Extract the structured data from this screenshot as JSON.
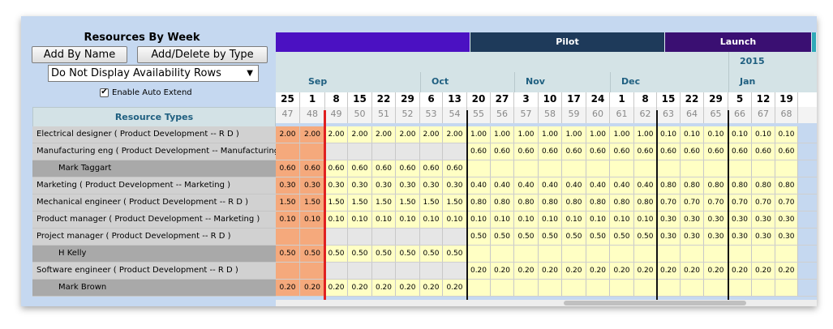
{
  "panel": {
    "title": "Resources By Week",
    "add_by_name_label": "Add By Name",
    "add_delete_label": "Add/Delete by Type",
    "availability_select": "Do Not Display Availability Rows",
    "auto_extend_label": "Enable Auto Extend",
    "auto_extend_checked": "✔"
  },
  "resource_header": "Resource Types",
  "phases": [
    {
      "label": "",
      "color": "#4b11c2"
    },
    {
      "label": "Pilot",
      "color": "#1e3a5a"
    },
    {
      "label": "Launch",
      "color": "#3a0f72"
    }
  ],
  "year_label": "2015",
  "months": [
    "Sep",
    "Oct",
    "Nov",
    "Dec",
    "Jan"
  ],
  "days": [
    "25",
    "1",
    "8",
    "15",
    "22",
    "29",
    "6",
    "13",
    "20",
    "27",
    "3",
    "10",
    "17",
    "24",
    "1",
    "8",
    "15",
    "22",
    "29",
    "5",
    "12",
    "19"
  ],
  "weeks": [
    "47",
    "48",
    "49",
    "50",
    "51",
    "52",
    "53",
    "54",
    "55",
    "56",
    "57",
    "58",
    "59",
    "60",
    "61",
    "62",
    "63",
    "64",
    "65",
    "66",
    "67",
    "68"
  ],
  "colors": {
    "past": "#f5a97c",
    "active": "#ffffc4",
    "empty": "#e6e6e6",
    "type_row": "#d1d1d1",
    "person_row": "#a9a9a9"
  },
  "rows": [
    {
      "label": "Electrical designer ( Product Development -- R D )",
      "kind": "type",
      "values": [
        "2.00",
        "2.00",
        "2.00",
        "2.00",
        "2.00",
        "2.00",
        "2.00",
        "2.00",
        "1.00",
        "1.00",
        "1.00",
        "1.00",
        "1.00",
        "1.00",
        "1.00",
        "1.00",
        "0.10",
        "0.10",
        "0.10",
        "0.10",
        "0.10",
        "0.10"
      ]
    },
    {
      "label": "Manufacturing eng ( Product Development -- Manufacturing )",
      "kind": "type",
      "values": [
        "",
        "",
        "",
        "",
        "",
        "",
        "",
        "",
        "0.60",
        "0.60",
        "0.60",
        "0.60",
        "0.60",
        "0.60",
        "0.60",
        "0.60",
        "0.60",
        "0.60",
        "0.60",
        "0.60",
        "0.60",
        "0.60"
      ]
    },
    {
      "label": "Mark Taggart",
      "kind": "person",
      "values": [
        "0.60",
        "0.60",
        "0.60",
        "0.60",
        "0.60",
        "0.60",
        "0.60",
        "0.60",
        "",
        "",
        "",
        "",
        "",
        "",
        "",
        "",
        "",
        "",
        "",
        "",
        "",
        ""
      ]
    },
    {
      "label": "Marketing ( Product Development -- Marketing )",
      "kind": "type",
      "values": [
        "0.30",
        "0.30",
        "0.30",
        "0.30",
        "0.30",
        "0.30",
        "0.30",
        "0.30",
        "0.40",
        "0.40",
        "0.40",
        "0.40",
        "0.40",
        "0.40",
        "0.40",
        "0.40",
        "0.80",
        "0.80",
        "0.80",
        "0.80",
        "0.80",
        "0.80"
      ]
    },
    {
      "label": "Mechanical engineer ( Product Development -- R D )",
      "kind": "type",
      "values": [
        "1.50",
        "1.50",
        "1.50",
        "1.50",
        "1.50",
        "1.50",
        "1.50",
        "1.50",
        "0.80",
        "0.80",
        "0.80",
        "0.80",
        "0.80",
        "0.80",
        "0.80",
        "0.80",
        "0.70",
        "0.70",
        "0.70",
        "0.70",
        "0.70",
        "0.70"
      ]
    },
    {
      "label": "Product manager ( Product Development -- Marketing )",
      "kind": "type",
      "values": [
        "0.10",
        "0.10",
        "0.10",
        "0.10",
        "0.10",
        "0.10",
        "0.10",
        "0.10",
        "0.10",
        "0.10",
        "0.10",
        "0.10",
        "0.10",
        "0.10",
        "0.10",
        "0.10",
        "0.30",
        "0.30",
        "0.30",
        "0.30",
        "0.30",
        "0.30"
      ]
    },
    {
      "label": "Project manager ( Product Development -- R D )",
      "kind": "type",
      "values": [
        "",
        "",
        "",
        "",
        "",
        "",
        "",
        "",
        "0.50",
        "0.50",
        "0.50",
        "0.50",
        "0.50",
        "0.50",
        "0.50",
        "0.50",
        "0.30",
        "0.30",
        "0.30",
        "0.30",
        "0.30",
        "0.30"
      ]
    },
    {
      "label": "H Kelly",
      "kind": "person",
      "values": [
        "0.50",
        "0.50",
        "0.50",
        "0.50",
        "0.50",
        "0.50",
        "0.50",
        "0.50",
        "",
        "",
        "",
        "",
        "",
        "",
        "",
        "",
        "",
        "",
        "",
        "",
        "",
        ""
      ]
    },
    {
      "label": "Software engineer ( Product Development -- R D )",
      "kind": "type",
      "values": [
        "",
        "",
        "",
        "",
        "",
        "",
        "",
        "",
        "0.20",
        "0.20",
        "0.20",
        "0.20",
        "0.20",
        "0.20",
        "0.20",
        "0.20",
        "0.20",
        "0.20",
        "0.20",
        "0.20",
        "0.20",
        "0.20"
      ]
    },
    {
      "label": "Mark Brown",
      "kind": "person",
      "values": [
        "0.20",
        "0.20",
        "0.20",
        "0.20",
        "0.20",
        "0.20",
        "0.20",
        "0.20",
        "",
        "",
        "",
        "",
        "",
        "",
        "",
        "",
        "",
        "",
        "",
        "",
        "",
        ""
      ]
    }
  ]
}
